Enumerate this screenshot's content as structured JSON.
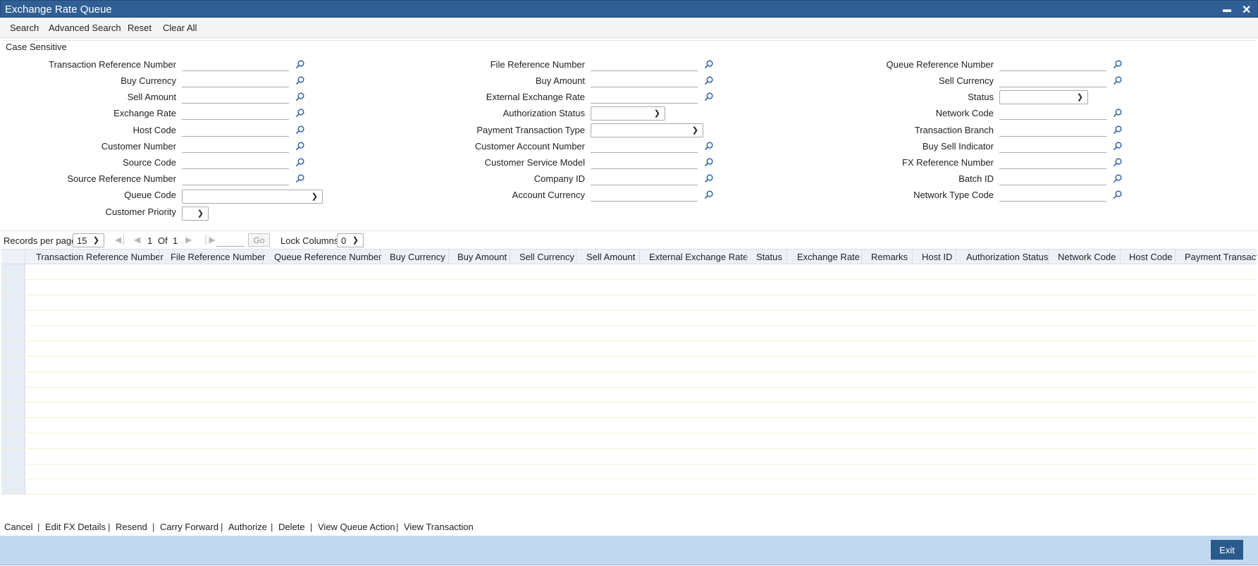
{
  "window": {
    "title": "Exchange Rate Queue",
    "minimize": "▬",
    "close": "✕"
  },
  "menu": {
    "search": "Search",
    "advanced_search": "Advanced Search",
    "reset": "Reset",
    "clear_all": "Clear All"
  },
  "form": {
    "case_sensitive": "Case Sensitive",
    "col1": [
      "Transaction Reference Number",
      "Buy Currency",
      "Sell Amount",
      "Exchange Rate",
      "Host Code",
      "Customer Number",
      "Source Code",
      "Source Reference Number",
      "Queue Code",
      "Customer Priority"
    ],
    "col2": [
      "File Reference Number",
      "Buy Amount",
      "External Exchange Rate",
      "Authorization Status",
      "Payment Transaction Type",
      "Customer Account Number",
      "Customer Service Model",
      "Company ID",
      "Account Currency"
    ],
    "col3": [
      "Queue Reference Number",
      "Sell Currency",
      "Status",
      "Network Code",
      "Transaction Branch",
      "Buy Sell Indicator",
      "FX Reference Number",
      "Batch ID",
      "Network Type Code"
    ]
  },
  "pager": {
    "records_per_page_label": "Records per page",
    "records_per_page_value": "15",
    "current_page": "1",
    "of_label": "Of",
    "total_pages": "1",
    "go_label": "Go",
    "lock_columns_label": "Lock Columns",
    "lock_columns_value": "0"
  },
  "grid": {
    "columns": [
      "Transaction Reference Number",
      "File Reference Number",
      "Queue Reference Number",
      "Buy Currency",
      "Buy Amount",
      "Sell Currency",
      "Sell Amount",
      "External Exchange Rate",
      "Status",
      "Exchange Rate",
      "Remarks",
      "Host ID",
      "Authorization Status",
      "Network Code",
      "Host Code",
      "Payment Transacti"
    ],
    "row_count": 15
  },
  "actions": [
    "Cancel",
    "Edit FX Details",
    "Resend",
    "Carry Forward",
    "Authorize",
    "Delete",
    "View Queue Action",
    "View Transaction"
  ],
  "footer": {
    "exit": "Exit"
  },
  "colors": {
    "titlebar": "#2f5f95",
    "footer": "#c1d9ef",
    "exit_button": "#2a5a8c",
    "search_icon": "#3a6ea5"
  }
}
